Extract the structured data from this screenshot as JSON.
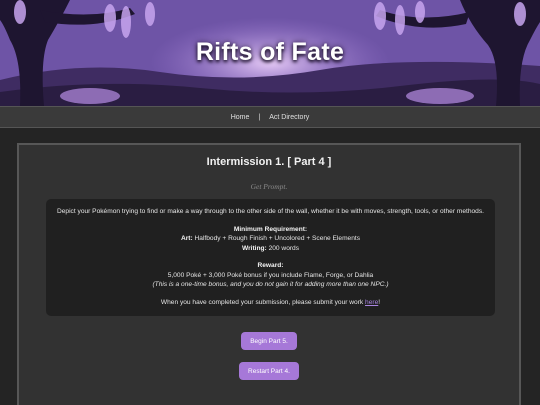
{
  "banner": {
    "title": "Rifts of Fate"
  },
  "nav": {
    "home": "Home",
    "separator": "|",
    "act_directory": "Act Directory"
  },
  "content": {
    "heading": "Intermission 1. [ Part 4 ]",
    "subtitle": "Get Prompt.",
    "prompt": "Depict your Pokémon trying to find or make a way through to the other side of the wall, whether it be with moves, strength, tools, or other methods.",
    "min_req_title": "Minimum Requirement:",
    "art_label": "Art:",
    "art_value": "Halfbody + Rough Finish + Uncolored + Scene Elements",
    "writing_label": "Writing:",
    "writing_value": "200 words",
    "reward_title": "Reward:",
    "reward_value": "5,000 Poké + 3,000 Poké bonus if you include Flame, Forge, or Dahlia",
    "reward_note": "(This is a one-time bonus, and you do not gain it for adding more than one NPC.)",
    "submit_text": "When you have completed your submission, please submit your work",
    "submit_link": "here",
    "submit_end": "!"
  },
  "buttons": {
    "begin": "Begin Part 5.",
    "restart": "Restart Part 4."
  },
  "colors": {
    "accent": "#a678d8",
    "link": "#a985e0",
    "background": "#242424",
    "panel": "#323232",
    "inner_box": "#202020"
  }
}
